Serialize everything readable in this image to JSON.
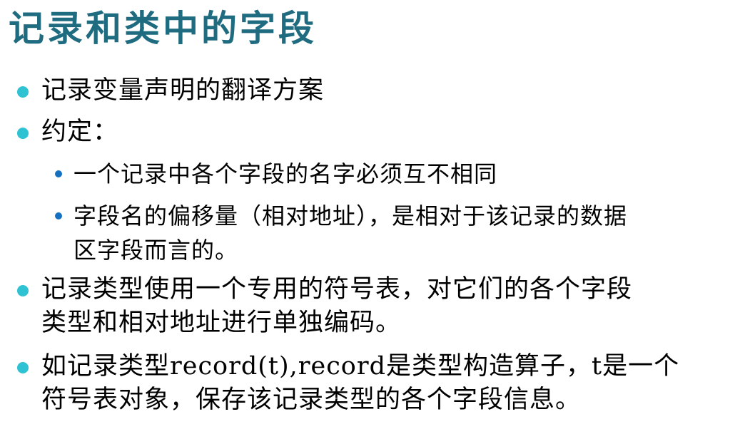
{
  "title": "记录和类中的字段",
  "bullets": [
    {
      "level": 1,
      "lines": [
        "记录变量声明的翻译方案"
      ]
    },
    {
      "level": 1,
      "lines": [
        "约定："
      ]
    },
    {
      "level": 2,
      "lines": [
        "一个记录中各个字段的名字必须互不相同"
      ]
    },
    {
      "level": 2,
      "lines": [
        "字段名的偏移量（相对地址），是相对于该记录的数据",
        "区字段而言的。"
      ]
    },
    {
      "level": 1,
      "lines": [
        "记录类型使用一个专用的符号表，对它们的各个字段",
        "类型和相对地址进行单独编码。"
      ]
    },
    {
      "level": 1,
      "lines": [
        "如记录类型record(t),record是类型构造算子，t是一个",
        "符号表对象，保存该记录类型的各个字段信息。"
      ]
    }
  ],
  "colors": {
    "title": "#1f6b80",
    "bullet_level1": "#2fc2d3",
    "bullet_level2": "#1570c0",
    "text": "#000000"
  }
}
